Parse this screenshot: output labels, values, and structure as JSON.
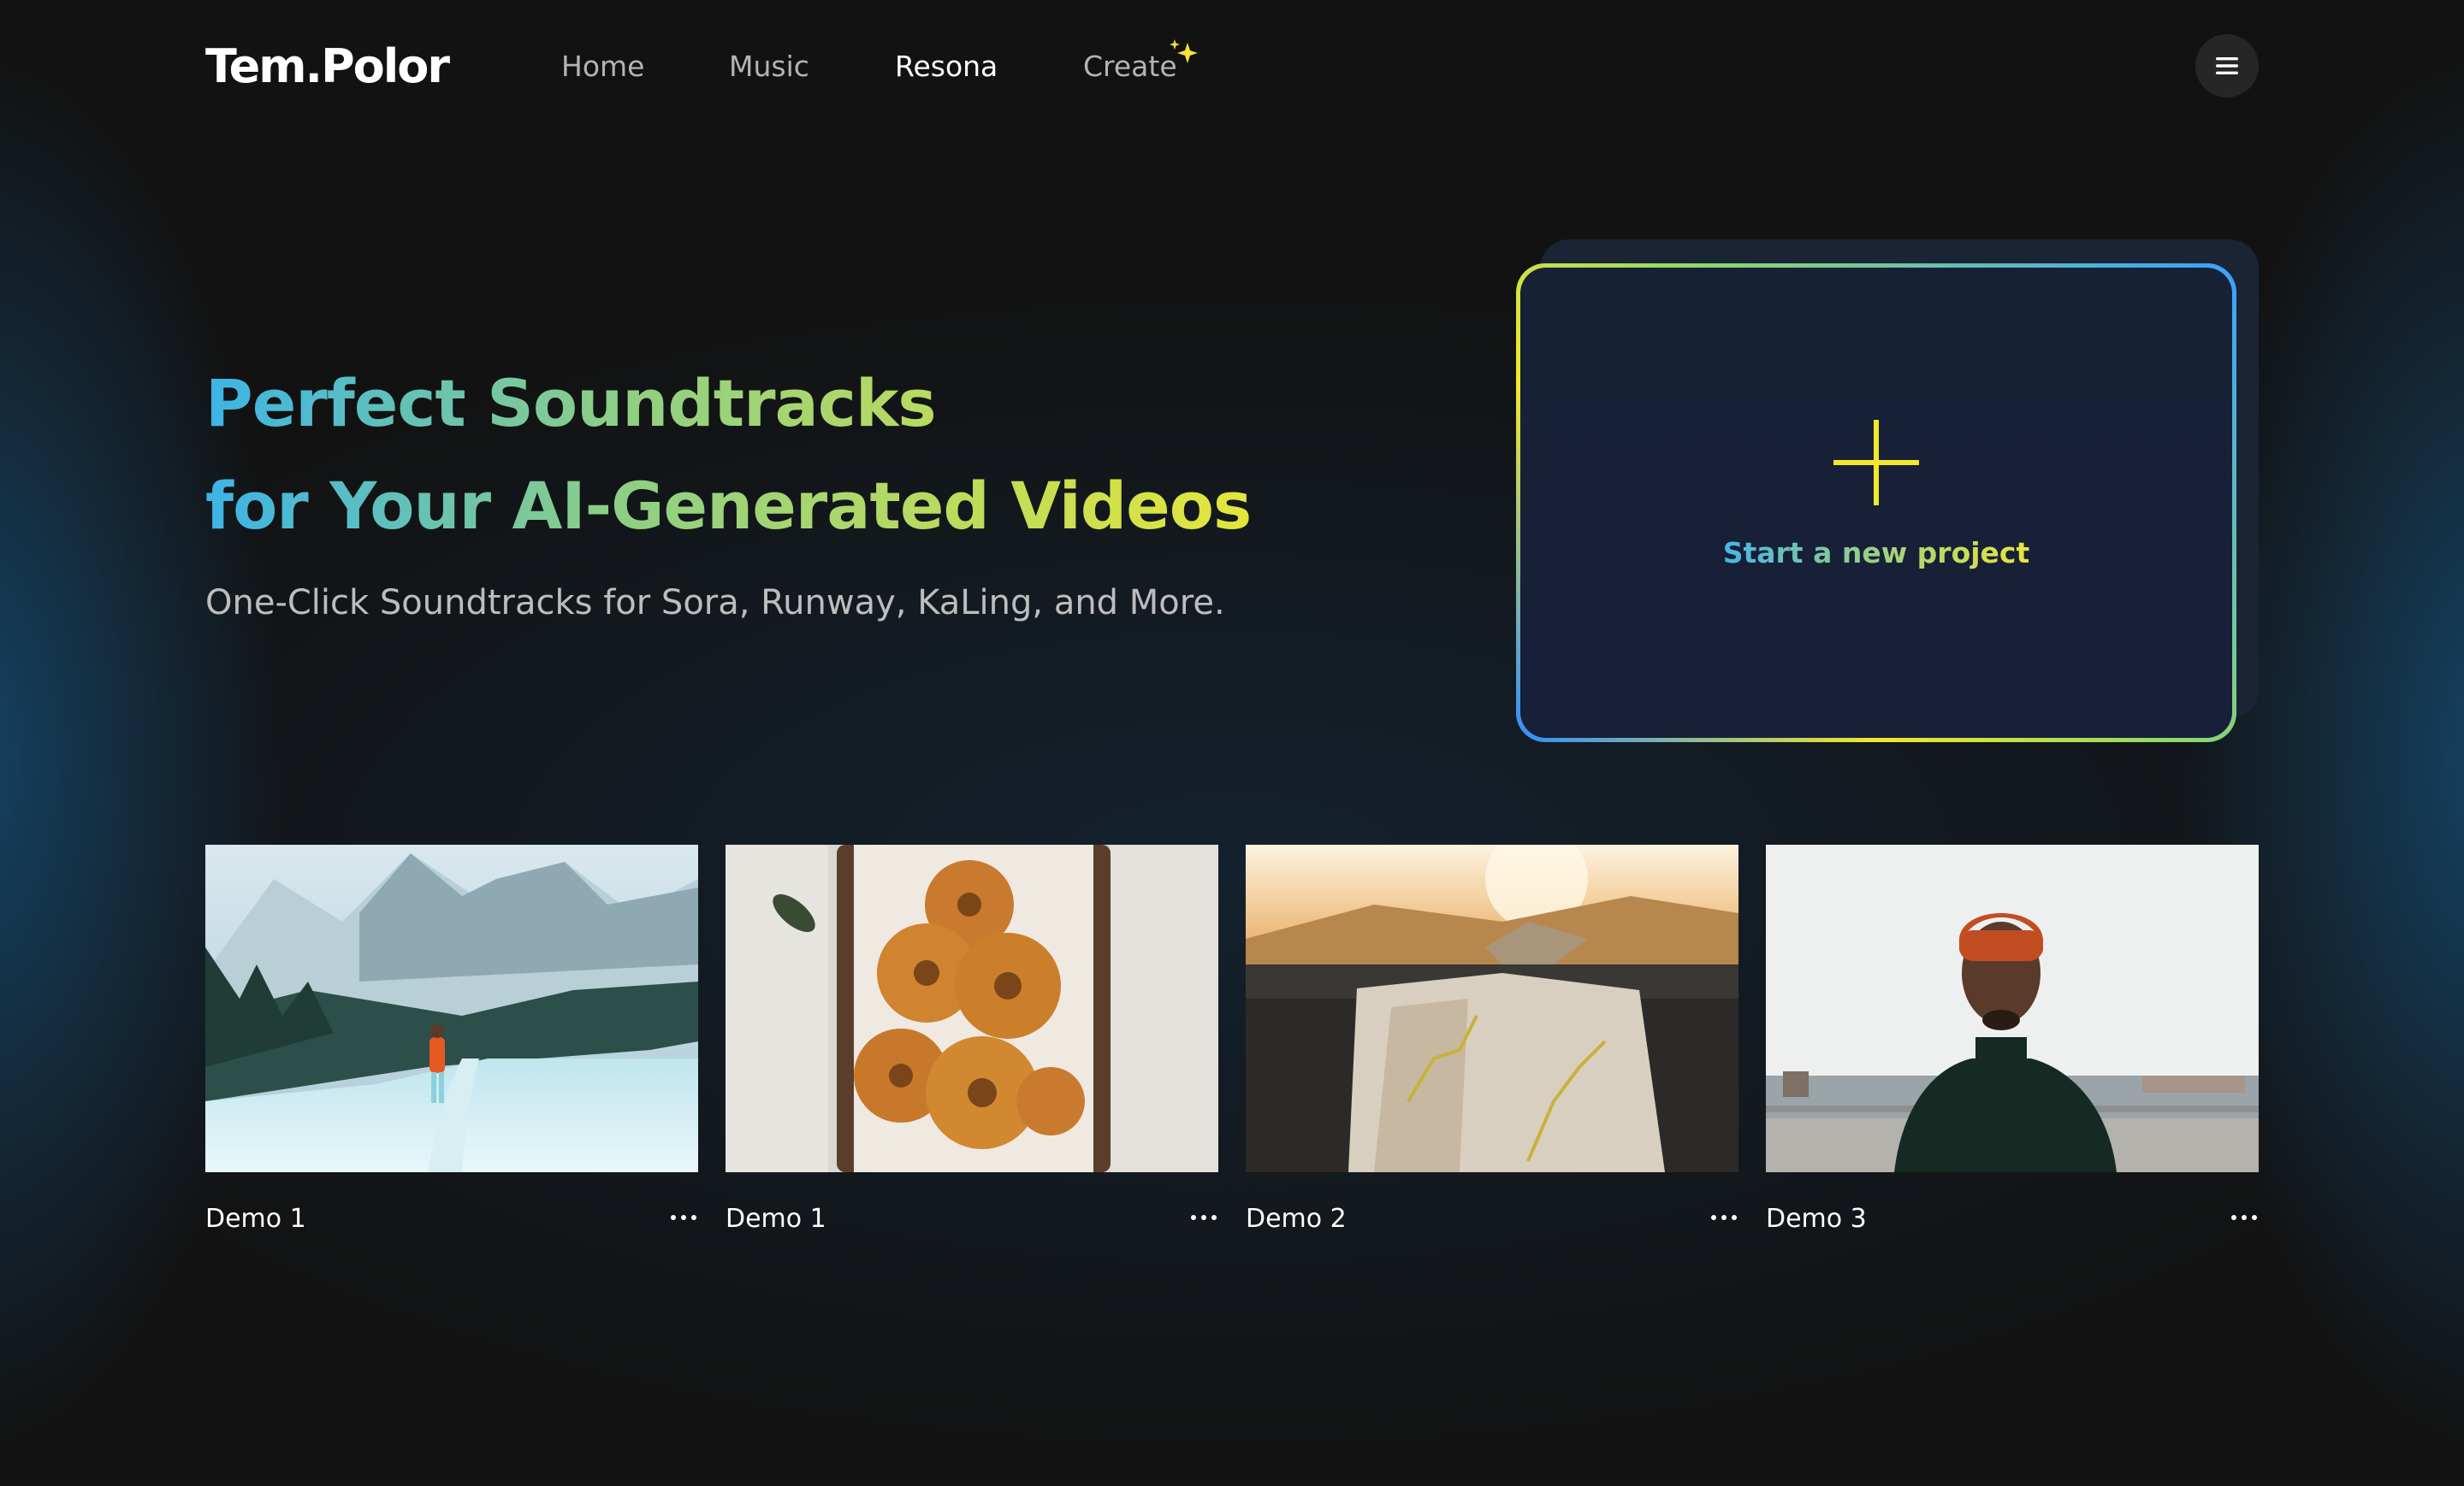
{
  "header": {
    "logo": "Tem.Polor",
    "nav": [
      {
        "label": "Home",
        "active": false
      },
      {
        "label": "Music",
        "active": false
      },
      {
        "label": "Resona",
        "active": true
      },
      {
        "label": "Create",
        "active": false,
        "icon": "sparkle-icon"
      }
    ],
    "menu_icon": "hamburger-menu-icon"
  },
  "hero": {
    "title_line1": "Perfect Soundtracks",
    "title_line2": "for Your AI-Generated Videos",
    "subtitle": "One-Click Soundtracks for Sora, Runway, KaLing, and More."
  },
  "project_card": {
    "label": "Start a new project",
    "icon": "plus-icon"
  },
  "demos": [
    {
      "title": "Demo 1",
      "thumbnail": "snowy-mountain-hiker"
    },
    {
      "title": "Demo 1",
      "thumbnail": "bagels-in-basket"
    },
    {
      "title": "Demo 2",
      "thumbnail": "map-on-car-dashboard"
    },
    {
      "title": "Demo 3",
      "thumbnail": "man-in-orange-beanie"
    }
  ],
  "colors": {
    "background": "#121212",
    "gradient_start": "#3cb4e6",
    "gradient_mid": "#8ecf84",
    "gradient_end": "#e4e63a",
    "card_bg": "#172038"
  }
}
